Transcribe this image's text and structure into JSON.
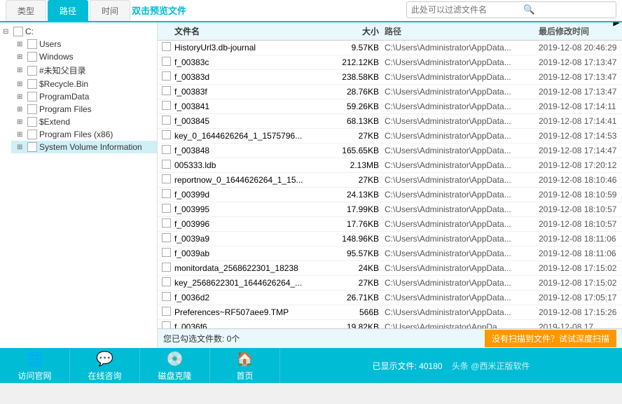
{
  "tabs": [
    {
      "id": "type",
      "label": "类型"
    },
    {
      "id": "path",
      "label": "路径"
    },
    {
      "id": "time",
      "label": "时间"
    }
  ],
  "active_tab": "path",
  "search": {
    "hint": "双击预览文件",
    "placeholder": "此处可以过滤文件名"
  },
  "tree": {
    "root": "C:",
    "items": [
      {
        "label": "Users",
        "indent": 1,
        "expanded": false
      },
      {
        "label": "Windows",
        "indent": 1,
        "expanded": false
      },
      {
        "label": "#未知父目录",
        "indent": 1,
        "expanded": false
      },
      {
        "label": "$Recycle.Bin",
        "indent": 1,
        "expanded": false
      },
      {
        "label": "ProgramData",
        "indent": 1,
        "expanded": false
      },
      {
        "label": "Program Files",
        "indent": 1,
        "expanded": false
      },
      {
        "label": "$Extend",
        "indent": 1,
        "expanded": false
      },
      {
        "label": "Program Files (x86)",
        "indent": 1,
        "expanded": false
      },
      {
        "label": "System Volume Information",
        "indent": 1,
        "expanded": false,
        "selected": true
      }
    ]
  },
  "table": {
    "headers": [
      "文件名",
      "大小",
      "路径",
      "最后修改时间"
    ],
    "rows": [
      {
        "name": "HistoryUrl3.db-journal",
        "size": "9.57KB",
        "path": "C:\\Users\\Administrator\\AppData...",
        "time": "2019-12-08 20:46:29"
      },
      {
        "name": "f_00383c",
        "size": "212.12KB",
        "path": "C:\\Users\\Administrator\\AppData...",
        "time": "2019-12-08 17:13:47"
      },
      {
        "name": "f_00383d",
        "size": "238.58KB",
        "path": "C:\\Users\\Administrator\\AppData...",
        "time": "2019-12-08 17:13:47"
      },
      {
        "name": "f_00383f",
        "size": "28.76KB",
        "path": "C:\\Users\\Administrator\\AppData...",
        "time": "2019-12-08 17:13:47"
      },
      {
        "name": "f_003841",
        "size": "59.26KB",
        "path": "C:\\Users\\Administrator\\AppData...",
        "time": "2019-12-08 17:14:11"
      },
      {
        "name": "f_003845",
        "size": "68.13KB",
        "path": "C:\\Users\\Administrator\\AppData...",
        "time": "2019-12-08 17:14:41"
      },
      {
        "name": "key_0_1644626264_1_1575796...",
        "size": "27KB",
        "path": "C:\\Users\\Administrator\\AppData...",
        "time": "2019-12-08 17:14:53"
      },
      {
        "name": "f_003848",
        "size": "165.65KB",
        "path": "C:\\Users\\Administrator\\AppData...",
        "time": "2019-12-08 17:14:47"
      },
      {
        "name": "005333.ldb",
        "size": "2.13MB",
        "path": "C:\\Users\\Administrator\\AppData...",
        "time": "2019-12-08 17:20:12"
      },
      {
        "name": "reportnow_0_1644626264_1_15...",
        "size": "27KB",
        "path": "C:\\Users\\Administrator\\AppData...",
        "time": "2019-12-08 18:10:46"
      },
      {
        "name": "f_00399d",
        "size": "24.13KB",
        "path": "C:\\Users\\Administrator\\AppData...",
        "time": "2019-12-08 18:10:59"
      },
      {
        "name": "f_003995",
        "size": "17.99KB",
        "path": "C:\\Users\\Administrator\\AppData...",
        "time": "2019-12-08 18:10:57"
      },
      {
        "name": "f_003996",
        "size": "17.76KB",
        "path": "C:\\Users\\Administrator\\AppData...",
        "time": "2019-12-08 18:10:57"
      },
      {
        "name": "f_0039a9",
        "size": "148.96KB",
        "path": "C:\\Users\\Administrator\\AppData...",
        "time": "2019-12-08 18:11:06"
      },
      {
        "name": "f_0039ab",
        "size": "95.57KB",
        "path": "C:\\Users\\Administrator\\AppData...",
        "time": "2019-12-08 18:11:06"
      },
      {
        "name": "monitordata_2568622301_18238",
        "size": "24KB",
        "path": "C:\\Users\\Administrator\\AppData...",
        "time": "2019-12-08 17:15:02"
      },
      {
        "name": "key_2568622301_1644626264_...",
        "size": "27KB",
        "path": "C:\\Users\\Administrator\\AppData...",
        "time": "2019-12-08 17:15:02"
      },
      {
        "name": "f_0036d2",
        "size": "26.71KB",
        "path": "C:\\Users\\Administrator\\AppData...",
        "time": "2019-12-08 17:05:17"
      },
      {
        "name": "Preferences~RF507aee9.TMP",
        "size": "566B",
        "path": "C:\\Users\\Administrator\\AppData...",
        "time": "2019-12-08 17:15:26"
      },
      {
        "name": "f_0036f6",
        "size": "19.82KB",
        "path": "C:\\Users\\Administrator\\AppDa...",
        "time": "2019-12-08 17..."
      }
    ]
  },
  "status": {
    "selected": "您已勾选文件数: 0个",
    "total": "已显示文件: 40180",
    "scan_hint": "没有扫描到文件？试试深度扫描"
  },
  "bottom": {
    "buttons": [
      {
        "id": "visit",
        "label": "访问官网",
        "icon": "🌐"
      },
      {
        "id": "consult",
        "label": "在线咨询",
        "icon": "💬"
      },
      {
        "id": "clone",
        "label": "磁盘克隆",
        "icon": "💿"
      },
      {
        "id": "home",
        "label": "首页",
        "icon": "🏠"
      }
    ],
    "watermark": "头条 @西米正版软件"
  }
}
